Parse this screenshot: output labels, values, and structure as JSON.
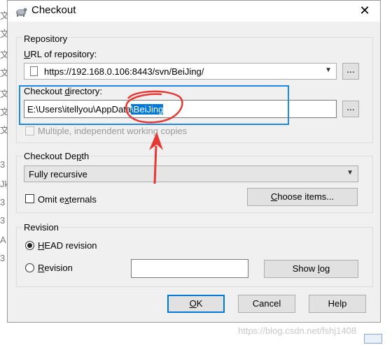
{
  "background": {
    "fragments": [
      "文",
      "文",
      "文",
      "文",
      "文",
      "文",
      "文",
      "3",
      "Jk",
      "3",
      "3",
      "A",
      "3"
    ]
  },
  "window": {
    "title": "Checkout",
    "close_symbol": "✕"
  },
  "repository": {
    "legend": "Repository",
    "url_label": "URL of repository:",
    "url_value": "https://192.168.0.106:8443/svn/BeiJing/",
    "browse_label": "...",
    "checkout_dir_label": "Checkout directory:",
    "checkout_dir_prefix": "E:\\Users\\itellyou\\AppData",
    "checkout_dir_selected": "\\BeiJing",
    "browse_dir_label": "...",
    "multiple_label": "Multiple, independent working copies",
    "multiple_checked": false
  },
  "depth": {
    "legend": "Checkout Depth",
    "selected": "Fully recursive",
    "omit_externals_label": "Omit externals",
    "omit_externals_checked": false,
    "choose_items_label": "Choose items..."
  },
  "revision": {
    "legend": "Revision",
    "head_label": "HEAD revision",
    "head_selected": true,
    "revision_label": "Revision",
    "revision_selected": false,
    "revision_value": "",
    "show_log_label": "Show log"
  },
  "buttons": {
    "ok": "OK",
    "cancel": "Cancel",
    "help": "Help"
  },
  "watermark": "https://blog.csdn.net/fshj1408",
  "colors": {
    "annotation_blue": "#1e88e5",
    "annotation_red": "#e53935",
    "selection": "#0078d7"
  }
}
